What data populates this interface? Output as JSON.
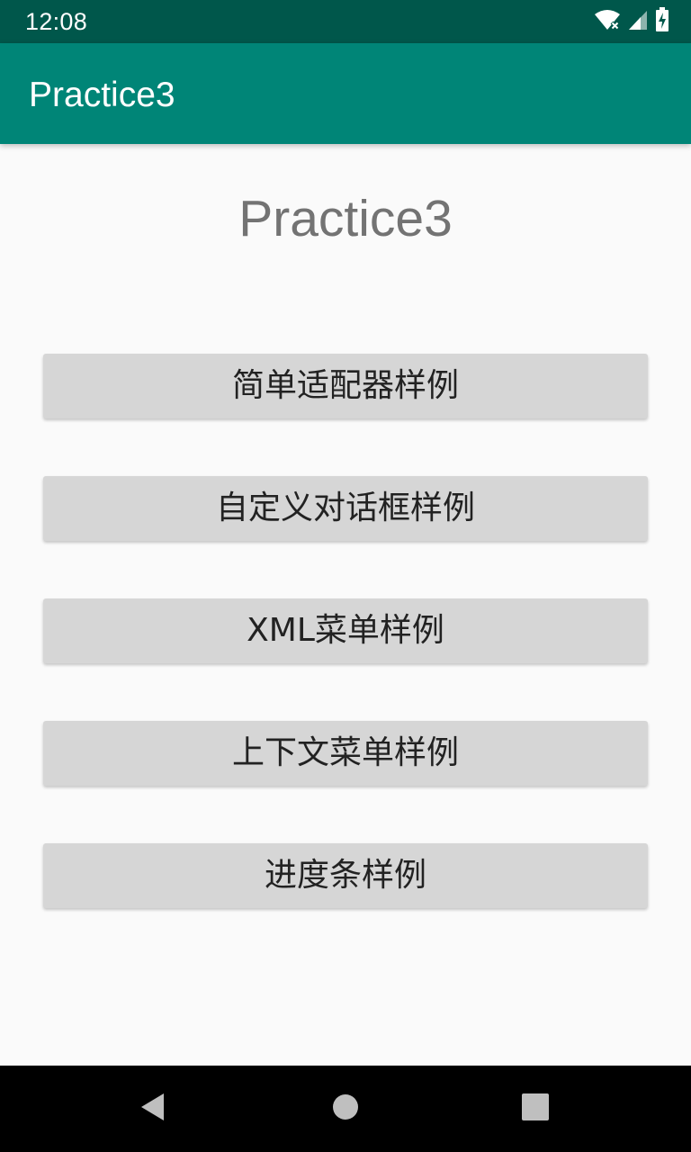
{
  "status_bar": {
    "time": "12:08",
    "icons": [
      "wifi-icon",
      "cellular-signal-icon",
      "battery-charging-icon"
    ]
  },
  "app_bar": {
    "title": "Practice3",
    "color": "#008577",
    "status_color": "#00574b"
  },
  "main": {
    "heading": "Practice3",
    "buttons": [
      {
        "label": "简单适配器样例"
      },
      {
        "label": "自定义对话框样例"
      },
      {
        "label": "XML菜单样例"
      },
      {
        "label": "上下文菜单样例"
      },
      {
        "label": "进度条样例"
      }
    ]
  },
  "nav_bar": {
    "icons": [
      "back-icon",
      "home-icon",
      "recents-icon"
    ]
  }
}
